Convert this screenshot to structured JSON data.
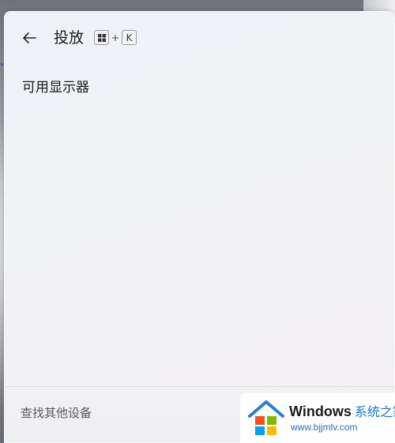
{
  "header": {
    "title": "投放",
    "shortcut": {
      "plus": "+",
      "key": "K"
    }
  },
  "section": {
    "heading": "可用显示器"
  },
  "footer": {
    "find_other_devices": "查找其他设备"
  },
  "watermark": {
    "brand": "Windows",
    "brand_suffix": "系统之家",
    "url": "www.bjjmlv.com"
  },
  "colors": {
    "accent": "#7a3fb0",
    "watermark_blue": "#1976c8"
  },
  "icons": {
    "back": "arrow-left-icon",
    "win_key": "windows-logo-icon"
  }
}
